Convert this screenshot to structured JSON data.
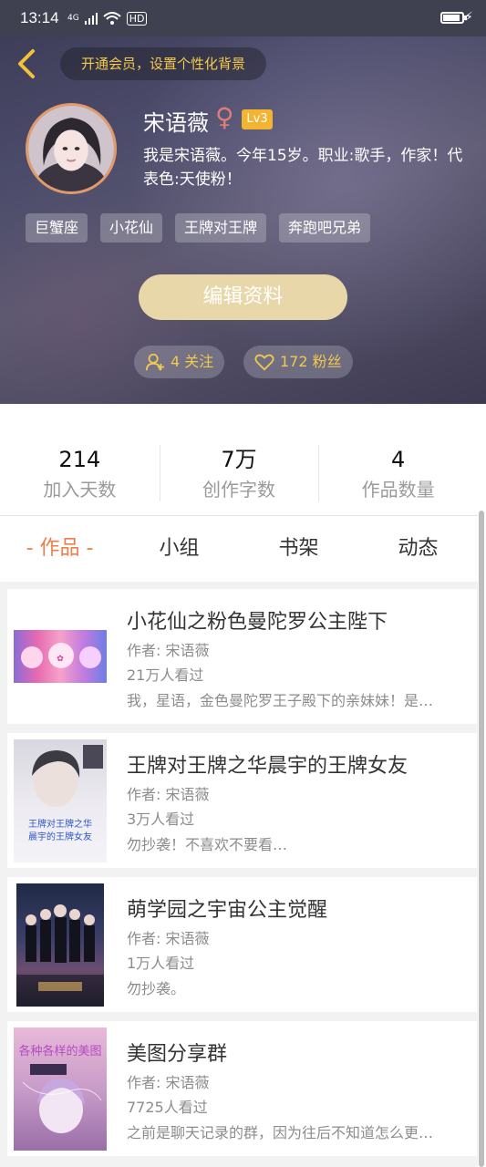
{
  "status_bar": {
    "time": "13:14",
    "network": "4G",
    "hd": "HD"
  },
  "header": {
    "vip_prompt": "开通会员，设置个性化背景",
    "username": "宋语薇",
    "gender_symbol": "♀",
    "level": "Lv3",
    "bio": "我是宋语薇。今年15岁。职业:歌手，作家！代表色:天使粉！",
    "tags": [
      "巨蟹座",
      "小花仙",
      "王牌对王牌",
      "奔跑吧兄弟"
    ],
    "edit_button": "编辑资料",
    "following": "4 关注",
    "followers": "172 粉丝"
  },
  "stats": [
    {
      "value": "214",
      "label": "加入天数"
    },
    {
      "value": "7万",
      "label": "创作字数"
    },
    {
      "value": "4",
      "label": "作品数量"
    }
  ],
  "tabs": [
    "- 作品 -",
    "小组",
    "书架",
    "动态"
  ],
  "works": [
    {
      "title": "小花仙之粉色曼陀罗公主陛下",
      "author": "作者: 宋语薇",
      "views": "21万人看过",
      "desc": "我，星语，金色曼陀罗王子殿下的亲妹妹！是…"
    },
    {
      "title": "王牌对王牌之华晨宇的王牌女友",
      "author": "作者: 宋语薇",
      "views": "3万人看过",
      "desc": "勿抄袭！不喜欢不要看…",
      "cover_text": "王牌对王牌之华晨宇的王牌女友"
    },
    {
      "title": "萌学园之宇宙公主觉醒",
      "author": "作者: 宋语薇",
      "views": "1万人看过",
      "desc": "勿抄袭。"
    },
    {
      "title": "美图分享群",
      "author": "作者: 宋语薇",
      "views": "7725人看过",
      "desc": "之前是聊天记录的群，因为往后不知道怎么更…",
      "cover_text": "各种各样的美图"
    }
  ],
  "colors": {
    "accent": "#f07d4a",
    "gold": "#f0c94f",
    "edit_button": "#e8d7a9",
    "level_badge": "#f2b431"
  }
}
